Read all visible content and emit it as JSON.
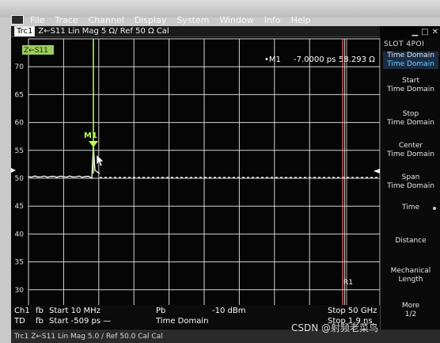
{
  "menu": [
    "File",
    "Trace",
    "Channel",
    "Display",
    "System",
    "Window",
    "Info",
    "Help"
  ],
  "trace_tab": {
    "channel": "Trc1",
    "setting": "Z←S11  Lin Mag  5 Ω/  Ref 50 Ω   Cal"
  },
  "plot": {
    "trace_label": "Z←S11",
    "y_ticks": [
      "70",
      "65",
      "60",
      "55",
      "50",
      "45",
      "40",
      "35",
      "30"
    ],
    "marker_readout": {
      "name": "•M1",
      "x": "-7.0000 ps",
      "y": "58.293 Ω"
    },
    "marker_label": "M1",
    "reference_label": "R1",
    "reference_marker_value": "50",
    "colors": {
      "trace": "#ffffff",
      "marker": "#b8ff4e",
      "limit": "#ff6a6a",
      "grid": "#ffffff"
    }
  },
  "softkeys": {
    "title": "SLOT 4POI",
    "items": [
      {
        "label": "Time Domain",
        "sub": "Time Domain",
        "active": true
      },
      {
        "label": "Start",
        "sub": "Time Domain"
      },
      {
        "label": "Stop",
        "sub": "Time Domain"
      },
      {
        "label": "Center",
        "sub": "Time Domain"
      },
      {
        "label": "Span",
        "sub": "Time Domain"
      },
      {
        "label": "Time",
        "sub": ""
      },
      {
        "label": "Distance",
        "sub": ""
      },
      {
        "label": "Mechanical",
        "sub": "Length"
      },
      {
        "label": "More",
        "sub": "1/2"
      }
    ]
  },
  "info": {
    "row1_ch": "Ch1",
    "row1_prefix": "fb",
    "row1_start": "Start  10 MHz",
    "row1_pb": "Pb",
    "row1_power": "-10 dBm",
    "row1_stop": "Stop  50 GHz",
    "row2_ch": "TD",
    "row2_prefix": "fb",
    "row2_start": "Start  -509 ps —",
    "row2_mode": "Time Domain",
    "row2_stop": "Stop  1.9 ns"
  },
  "statusbar": "Trc1   Z←S11   Lin Mag   5.0 / Ref 50.0   Cal   Cal",
  "watermark": "CSDN @射频老菜鸟"
}
